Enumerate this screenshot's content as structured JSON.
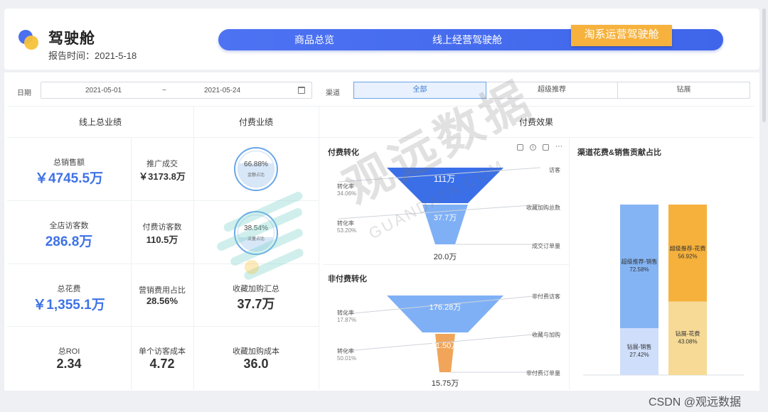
{
  "header": {
    "title": "驾驶舱",
    "report_time": "报告时间：2021-5-18",
    "tabs": [
      "商品总览",
      "线上经营驾驶舱",
      "淘系运营驾驶舱"
    ]
  },
  "filters": {
    "date_label": "日期",
    "date_start": "2021-05-01",
    "date_sep": "~",
    "date_end": "2021-05-24",
    "channel_label": "渠道",
    "channels": [
      "全部",
      "超级推荐",
      "钻展"
    ],
    "selected_channel": "全部"
  },
  "online_total": {
    "title": "线上总业绩",
    "metrics": [
      {
        "label": "总销售额",
        "value": "￥4745.5万"
      },
      {
        "label": "推广成交",
        "value": "￥3173.8万"
      },
      {
        "label": "全店访客数",
        "value": "286.8万"
      },
      {
        "label": "付费访客数",
        "value": "110.5万"
      },
      {
        "label": "总花费",
        "value": "￥1,355.1万"
      },
      {
        "label": "营销费用占比",
        "value": "28.56%"
      },
      {
        "label": "总ROI",
        "value": "2.34"
      },
      {
        "label": "单个访客成本",
        "value": "4.72"
      }
    ]
  },
  "paid_perf": {
    "title": "付费业绩",
    "gauges": [
      {
        "percent": "66.88%",
        "label": "金额占比",
        "level": 0.6688
      },
      {
        "percent": "38.54%",
        "label": "流量占比",
        "level": 0.3854
      }
    ],
    "metrics": [
      {
        "label": "收藏加购汇总",
        "value": "37.7万"
      },
      {
        "label": "收藏加购成本",
        "value": "36.0"
      }
    ]
  },
  "paid_effect": {
    "title": "付费效果",
    "paid_conversion": {
      "title": "付费转化",
      "stages": [
        {
          "name": "访客",
          "value": "111万"
        },
        {
          "name": "收藏加购总数",
          "value": "37.7万"
        },
        {
          "name": "成交订单量",
          "value": "20.0万"
        }
      ],
      "rates": [
        {
          "label": "转化率",
          "value": "34.06%"
        },
        {
          "label": "转化率",
          "value": "53.20%"
        }
      ]
    },
    "nonpaid_conversion": {
      "title": "非付费转化",
      "stages": [
        {
          "name": "非付费访客",
          "value": "176.28万"
        },
        {
          "name": "收藏与加购",
          "value": "31.50万"
        },
        {
          "name": "非付费订单量",
          "value": "15.75万"
        }
      ],
      "rates": [
        {
          "label": "转化率",
          "value": "17.87%"
        },
        {
          "label": "转化率",
          "value": "50.01%"
        }
      ]
    },
    "contribution": {
      "title": "渠道花费&销售贡献占比",
      "bars": [
        {
          "segments": [
            {
              "name": "超级推荐-销售",
              "value": "72.58%",
              "share": 72.58,
              "color": "#84b4f3"
            },
            {
              "name": "钻展-销售",
              "value": "27.42%",
              "share": 27.42,
              "color": "#cfdefa"
            }
          ]
        },
        {
          "segments": [
            {
              "name": "超级推荐-花费",
              "value": "56.92%",
              "share": 56.92,
              "color": "#f6b13c"
            },
            {
              "name": "钻展-花费",
              "value": "43.08%",
              "share": 43.08,
              "color": "#f6da96"
            }
          ]
        }
      ]
    }
  },
  "watermark": {
    "cn": "观远数据",
    "en": "GUANDATA.COM"
  },
  "credit": "CSDN @观远数据",
  "colors": {
    "nav": "#4568ee",
    "nav_active": "#f6b23d",
    "value_blue": "#3e72e6",
    "funnel_blue": "#3a6fe8",
    "funnel_light": "#7fb0f5",
    "funnel_orange": "#f0a55a"
  }
}
